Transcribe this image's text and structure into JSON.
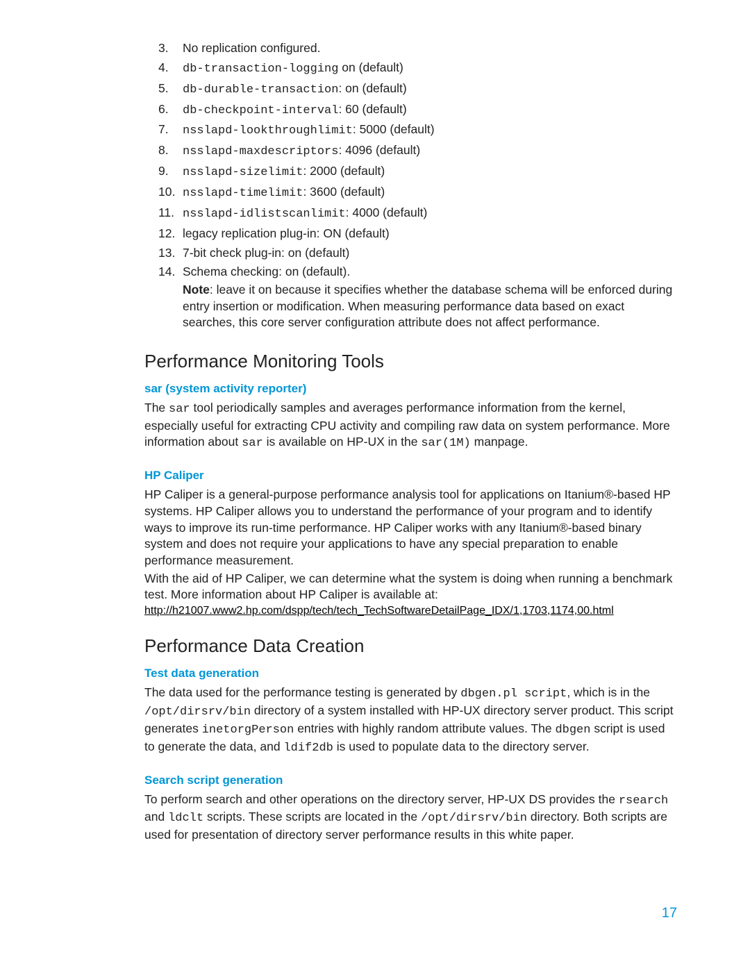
{
  "list": {
    "items": [
      {
        "num": "3.",
        "plain": "No replication configured."
      },
      {
        "num": "4.",
        "mono": "db-transaction-logging",
        "after": " on (default)"
      },
      {
        "num": "5.",
        "mono": "db-durable-transaction",
        "after": ": on (default)"
      },
      {
        "num": "6.",
        "mono": "db-checkpoint-interval",
        "after": ": 60 (default)"
      },
      {
        "num": "7.",
        "mono": "nsslapd-lookthroughlimit",
        "after": ": 5000 (default)"
      },
      {
        "num": "8.",
        "mono": "nsslapd-maxdescriptors",
        "after": ": 4096 (default)"
      },
      {
        "num": "9.",
        "mono": "nsslapd-sizelimit",
        "after": ": 2000 (default)"
      },
      {
        "num": "10.",
        "mono": "nsslapd-timelimit",
        "after": ": 3600 (default)"
      },
      {
        "num": "11.",
        "mono": "nsslapd-idlistscanlimit",
        "after": ": 4000 (default)"
      },
      {
        "num": "12.",
        "plain": "legacy replication plug-in: ON (default)"
      },
      {
        "num": "13.",
        "plain": "7-bit check plug-in: on (default)"
      },
      {
        "num": "14.",
        "plain": "Schema checking: on (default)."
      }
    ],
    "note_label": "Note",
    "note_text": ": leave it on because it specifies whether the database schema will be enforced during entry insertion or modification.  When measuring performance data based on exact searches, this core server configuration attribute does not affect performance."
  },
  "monitoring": {
    "heading": "Performance Monitoring Tools",
    "sar": {
      "heading": "sar (system activity reporter)",
      "pre": "The ",
      "m1": "sar",
      "mid1": " tool periodically samples and averages performance information from the kernel, especially useful for extracting CPU activity and compiling raw data on system performance.  More information about ",
      "m2": "sar",
      "mid2": " is available on HP-UX in the ",
      "m3": "sar(1M)",
      "post": " manpage."
    },
    "caliper": {
      "heading": "HP Caliper",
      "p1": "HP Caliper is a general-purpose performance analysis tool for applications on Itanium®-based HP systems. HP Caliper allows you to understand the performance of your program and to identify ways to improve its run-time performance. HP Caliper works with any Itanium®-based binary system and does not require your applications to have any special preparation to enable performance measurement.",
      "p2": "With the aid of HP Caliper, we can determine what the system is doing when running a benchmark test.  More information about HP Caliper is available at:",
      "link": "http://h21007.www2.hp.com/dspp/tech/tech_TechSoftwareDetailPage_IDX/1,1703,1174,00.html"
    }
  },
  "creation": {
    "heading": "Performance Data Creation",
    "testdata": {
      "heading": "Test data generation",
      "s1": "The data used for the performance testing is generated by ",
      "m1": "dbgen.pl script",
      "s2": ", which is in the ",
      "m2": "/opt/dirsrv/bin",
      "s3": " directory of a system installed with HP-UX directory server product.  This script generates ",
      "m3": "inetorgPerson",
      "s4": " entries with highly random attribute values. The ",
      "m4": "dbgen",
      "s5": " script is used to generate the data, and ",
      "m5": "ldif2db",
      "s6": " is used to populate data to the directory server."
    },
    "search": {
      "heading": "Search script generation",
      "s1": "To perform search and other operations on the directory server, HP-UX DS provides the ",
      "m1": "rsearch",
      "s2": " and ",
      "m2": "ldclt",
      "s3": " scripts. These scripts are located in the ",
      "m3": "/opt/dirsrv/bin",
      "s4": " directory. Both scripts are used for presentation of directory server performance results in this white paper."
    }
  },
  "page_number": "17"
}
